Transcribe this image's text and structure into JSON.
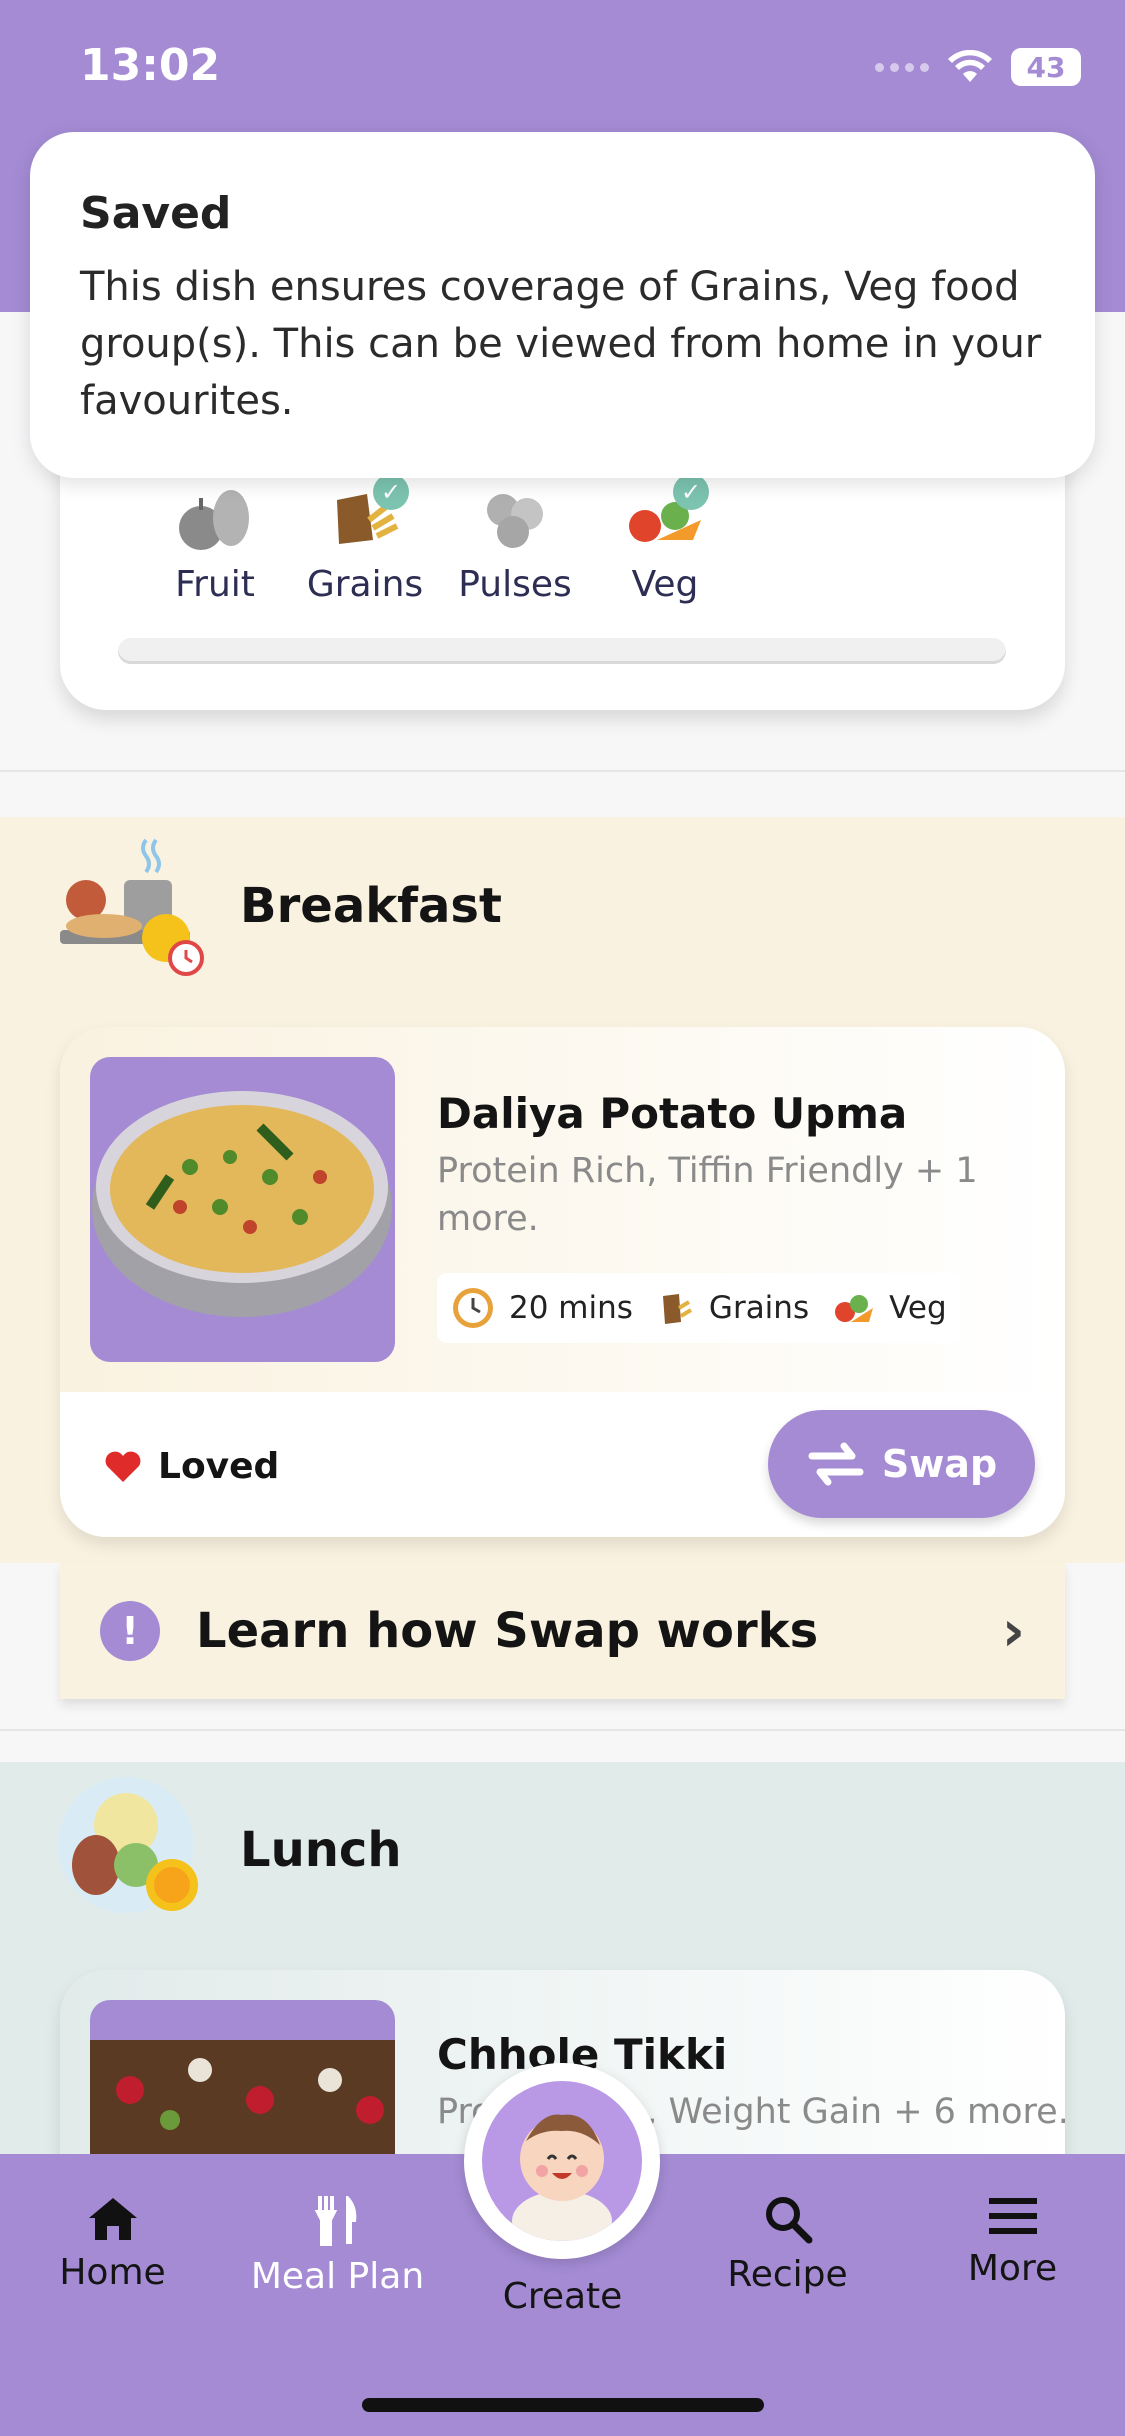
{
  "status_bar": {
    "time": "13:02",
    "battery": "43"
  },
  "toast": {
    "title": "Saved",
    "message": "This dish ensures coverage of Grains, Veg food group(s). This can be viewed from home in your favourites."
  },
  "food_groups": [
    {
      "label": "Fruit",
      "icon": "fruit-icon",
      "covered": false
    },
    {
      "label": "Grains",
      "icon": "grains-icon",
      "covered": true
    },
    {
      "label": "Pulses",
      "icon": "pulses-icon",
      "covered": false
    },
    {
      "label": "Veg",
      "icon": "veg-icon",
      "covered": true
    }
  ],
  "breakfast": {
    "title": "Breakfast",
    "meal": {
      "name": "Daliya Potato Upma",
      "tags": "Protein Rich, Tiffin Friendly + 1 more.",
      "time": "20 mins",
      "group1": "Grains",
      "group2": "Veg",
      "loved_label": "Loved",
      "swap_label": "Swap"
    }
  },
  "learn_swap": {
    "label": "Learn how Swap works"
  },
  "lunch": {
    "title": "Lunch",
    "meal": {
      "name": "Chhole Tikki",
      "tags": "Protein Rich, Weight Gain + 6 more."
    }
  },
  "tabs": {
    "home": "Home",
    "meal_plan": "Meal Plan",
    "create": "Create",
    "recipe": "Recipe",
    "more": "More"
  },
  "colors": {
    "brand": "#a48bd4",
    "breakfast_bg": "#faf2e0",
    "lunch_bg": "#e1ebea"
  }
}
